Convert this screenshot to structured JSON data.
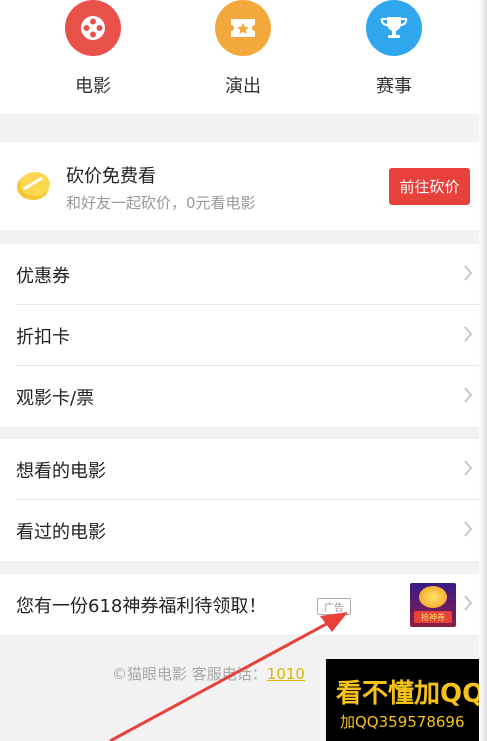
{
  "categories": [
    {
      "label": "电影",
      "color": "#e8504a",
      "icon": "film-reel-icon"
    },
    {
      "label": "演出",
      "color": "#f3a83b",
      "icon": "ticket-icon"
    },
    {
      "label": "赛事",
      "color": "#2fa7ef",
      "icon": "trophy-icon"
    }
  ],
  "banner": {
    "title": "砍价免费看",
    "subtitle": "和好友一起砍价，0元看电影",
    "button": "前往砍价",
    "button_color": "#e8403b"
  },
  "menu_group_1": [
    {
      "label": "优惠券"
    },
    {
      "label": "折扣卡"
    },
    {
      "label": "观影卡/票"
    }
  ],
  "menu_group_2": [
    {
      "label": "想看的电影"
    },
    {
      "label": "看过的电影"
    }
  ],
  "ad": {
    "text": "您有一份618神券福利待领取！",
    "tag": "广告",
    "image_caption": "抢神券"
  },
  "footer": {
    "text": "©猫眼电影 客服电话：",
    "phone": "1010"
  },
  "watermark": {
    "line1": "看不懂加QQ",
    "line2": "加QQ359578696"
  },
  "colors": {
    "accent": "#e8403b",
    "arrow": "#e8403b"
  }
}
